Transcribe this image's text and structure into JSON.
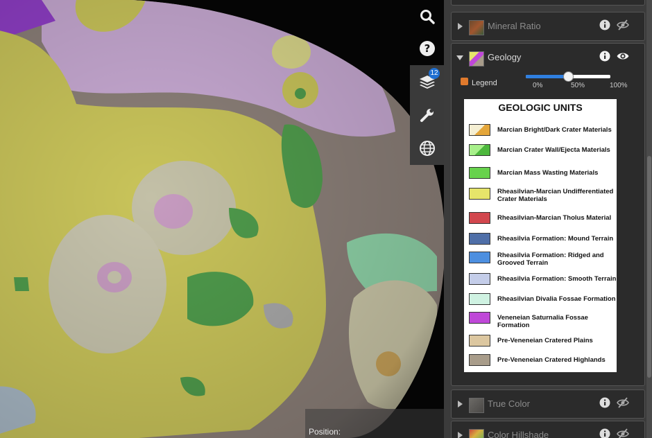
{
  "viewport": {
    "position_label": "Position:"
  },
  "toolbar": {
    "search_icon": "search-icon",
    "help_icon": "help-icon",
    "layers_icon": "layers-icon",
    "layers_badge": "12",
    "tools_icon": "wrench-icon",
    "globe_icon": "globe-icon"
  },
  "layers": {
    "mineral_ratio": {
      "name": "Mineral Ratio",
      "visible": false
    },
    "geology": {
      "name": "Geology",
      "visible": true,
      "expanded": true,
      "legend_label": "Legend",
      "opacity_percent": 50,
      "slider_ticks": [
        "0%",
        "50%",
        "100%"
      ]
    },
    "true_color": {
      "name": "True Color",
      "visible": false
    },
    "color_hillshade": {
      "name": "Color Hillshade",
      "visible": false
    }
  },
  "legend": {
    "title": "GEOLOGIC UNITS",
    "items": [
      {
        "label": "Marcian Bright/Dark Crater Materials",
        "color": "#f5efd3",
        "color2": "#e4a63a"
      },
      {
        "label": "Marcian Crater Wall/Ejecta Materials",
        "color": "#a8f08b",
        "color2": "#4db83d"
      },
      {
        "label": "Marcian Mass Wasting Materials",
        "color": "#67d24c"
      },
      {
        "label": "Rheasilvian-Marcian Undifferentiated Crater Materials",
        "color": "#e6e56a"
      },
      {
        "label": "Rheasilvian-Marcian Tholus Material",
        "color": "#d2474e"
      },
      {
        "label": "Rheasilvia Formation: Mound Terrain",
        "color": "#4f6fa8"
      },
      {
        "label": "Rheasilvia Formation: Ridged and Grooved Terrain",
        "color": "#4d8fe0"
      },
      {
        "label": "Rheasilvia Formation: Smooth Terrain",
        "color": "#c4cde9"
      },
      {
        "label": "Rheasilvian Divalia Fossae Formation",
        "color": "#cff2e2"
      },
      {
        "label": "Veneneian Saturnalia Fossae Formation",
        "color": "#bf48d8"
      },
      {
        "label": "Pre-Veneneian Cratered Plains",
        "color": "#dcc7a0"
      },
      {
        "label": "Pre-Veneneian Cratered Highlands",
        "color": "#a89c8a"
      }
    ]
  },
  "colors": {
    "accent": "#2f7fe0",
    "checkbox": "#e07a2d",
    "panel_bg": "#3b3b3b",
    "row_bg": "#2b2b2b"
  }
}
